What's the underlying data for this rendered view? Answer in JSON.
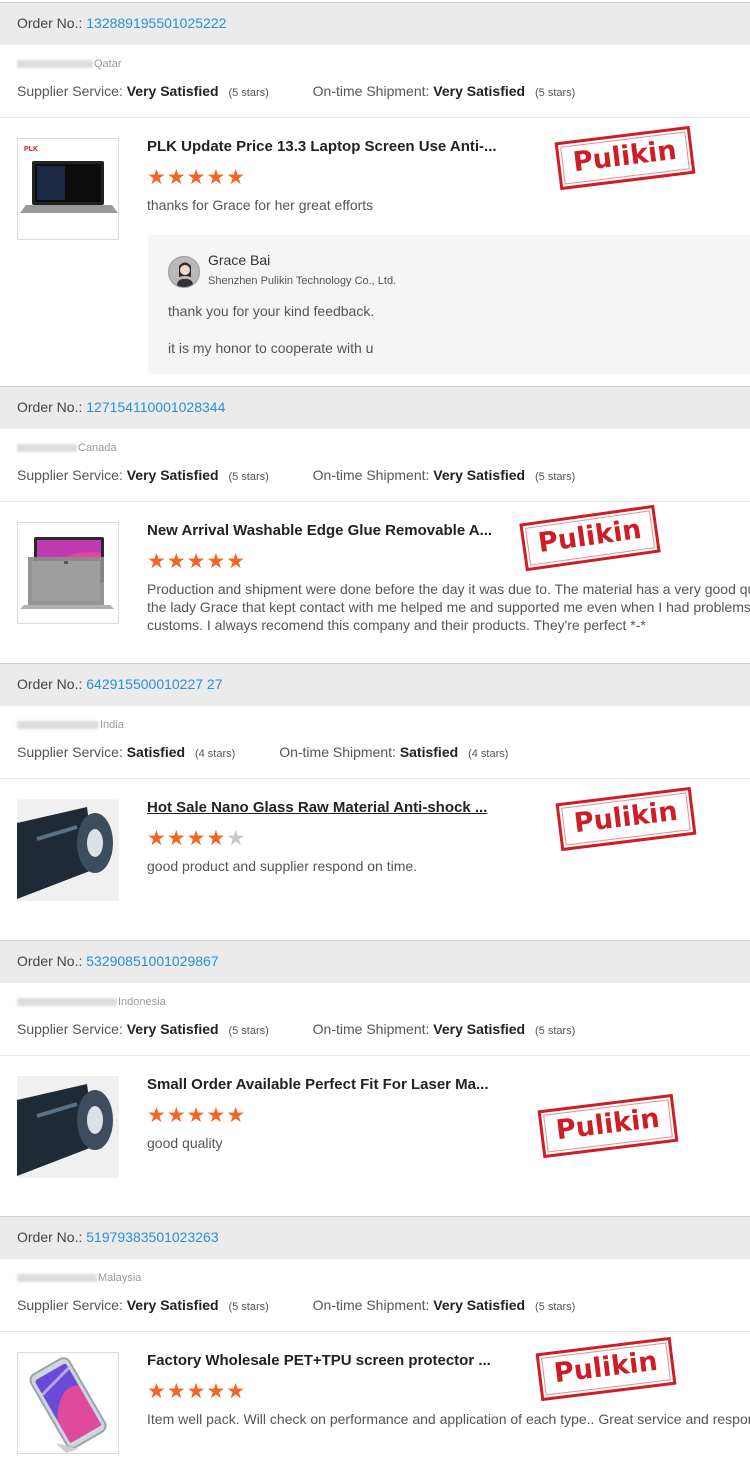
{
  "labels": {
    "order_no": "Order No.:",
    "supplier_service": "Supplier Service:",
    "ontime_shipment": "On-time Shipment:"
  },
  "stamp_text": "Pulikin",
  "accent_color": "#2a8fd6",
  "star_color": "#f26522",
  "orders": [
    {
      "order_no": "132889195501025222",
      "country": "Qatar",
      "supplier_rating": "Very Satisfied",
      "supplier_stars": "(5 stars)",
      "shipment_rating": "Very Satisfied",
      "shipment_stars": "(5 stars)",
      "title": "PLK Update Price 13.3 Laptop Screen Use Anti-...",
      "stars": 5,
      "review_lines": [
        "thanks for Grace for her great efforts"
      ],
      "thumb_icon": "laptop-privacy-screen-icon",
      "reply": {
        "name": "Grace Bai",
        "company": "Shenzhen Pulikin Technology Co., Ltd.",
        "lines": [
          "thank you for your kind feedback.",
          "it is my honor to cooperate with u"
        ]
      }
    },
    {
      "order_no": "127154110001028344",
      "country": "Canada",
      "supplier_rating": "Very Satisfied",
      "supplier_stars": "(5 stars)",
      "shipment_rating": "Very Satisfied",
      "shipment_stars": "(5 stars)",
      "title": "New Arrival Washable Edge Glue Removable A...",
      "stars": 5,
      "review_lines": [
        "Production and shipment were done before the day it was due to. The material has a very good qua",
        "the lady Grace that kept contact with me helped me and supported me even when I had problems w",
        "customs. I always recomend this company and their products. They're perfect *-*"
      ],
      "thumb_icon": "laptop-screen-protector-icon"
    },
    {
      "order_no": "642915500010227 27",
      "country": "India",
      "supplier_rating": "Satisfied",
      "supplier_stars": "(4 stars)",
      "shipment_rating": "Satisfied",
      "shipment_stars": "(4 stars)",
      "title": "Hot Sale Nano Glass Raw Material Anti-shock ...",
      "stars": 4,
      "review_lines": [
        "good product and supplier respond on time."
      ],
      "thumb_icon": "film-roll-icon"
    },
    {
      "order_no": "53290851001029867",
      "country": "Indonesia",
      "supplier_rating": "Very Satisfied",
      "supplier_stars": "(5 stars)",
      "shipment_rating": "Very Satisfied",
      "shipment_stars": "(5 stars)",
      "title": "Small Order Available Perfect Fit For Laser Ma...",
      "stars": 5,
      "review_lines": [
        "good quality"
      ],
      "thumb_icon": "film-roll-icon"
    },
    {
      "order_no": "51979383501023263",
      "country": "Malaysia",
      "supplier_rating": "Very Satisfied",
      "supplier_stars": "(5 stars)",
      "shipment_rating": "Very Satisfied",
      "shipment_stars": "(5 stars)",
      "title": "Factory Wholesale PET+TPU screen protector ...",
      "stars": 5,
      "review_lines": [
        "Item well pack. Will check on performance and application of each type.. Great service and respons"
      ],
      "thumb_icon": "phone-screen-protector-icon"
    }
  ]
}
